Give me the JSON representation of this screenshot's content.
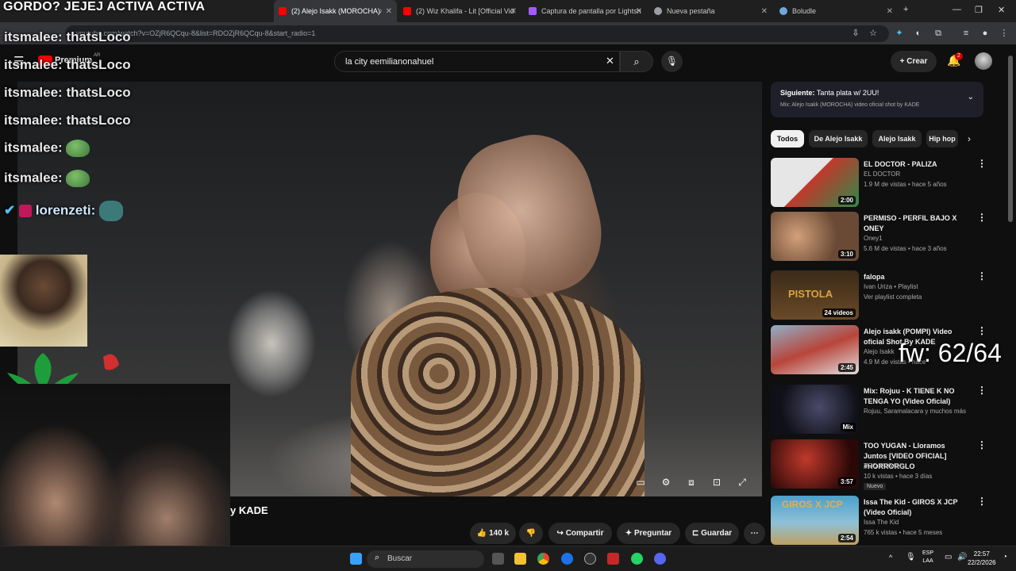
{
  "stream_overlay": {
    "banner": "GORDO? JEJEJ ACTIVA ACTIVA",
    "chat": [
      {
        "user": "itsmalee:",
        "text": "thatsLoco"
      },
      {
        "user": "itsmalee:",
        "text": "thatsLoco"
      },
      {
        "user": "itsmalee:",
        "text": "thatsLoco"
      },
      {
        "user": "itsmalee:",
        "text": "thatsLoco"
      },
      {
        "user": "itsmalee:",
        "text": ""
      },
      {
        "user": "itsmalee:",
        "text": ""
      },
      {
        "user": "lorenzeti:",
        "text": ""
      }
    ],
    "fw_counter": "fw: 62/64"
  },
  "browser": {
    "tabs": [
      {
        "label": "(2) Alejo Isakk (MOROCHA)",
        "color": "#ff0000"
      },
      {
        "label": "(2) Wiz Khalifa - Lit [Official Vid",
        "color": "#ff0000"
      },
      {
        "label": "Captura de pantalla por Lightsh",
        "color": "#a259ff"
      },
      {
        "label": "Nueva pestaña",
        "color": "#9aa0a6"
      },
      {
        "label": "Boludle",
        "color": "#6fa8dc"
      }
    ],
    "url": "youtube.com/watch?v=OZjR6QCqu-8&list=RDOZjR6QCqu-8&start_radio=1"
  },
  "youtube": {
    "logo": "Premium",
    "logo_region": "AR",
    "search_value": "la city eemilianonahuel",
    "create_label": "Crear",
    "notif_count": "2",
    "video_title_fragment": "y KADE",
    "actions": {
      "likes": "140 k",
      "share": "Compartir",
      "ask": "Preguntar",
      "save": "Guardar"
    },
    "next": {
      "label": "Siguiente:",
      "title": "Tanta plata w/ 2UU!",
      "sub": "Mix: Alejo Isakk (MOROCHA) video oficial shot by KADE"
    },
    "chips": [
      "Todos",
      "De Alejo Isakk",
      "Alejo Isakk",
      "Hip hop"
    ],
    "recommendations": [
      {
        "title": "EL DOCTOR - PALIZA",
        "channel": "EL DOCTOR",
        "meta": "1.9 M de vistas • hace 5 años",
        "badge": "2:00",
        "colors": [
          "#e6e6e6",
          "#c0392b"
        ]
      },
      {
        "title": "PERMISO - PERFIL BAJO X ONEY",
        "channel": "Oney1",
        "meta": "5.6 M de vistas • hace 3 años",
        "badge": "3:10",
        "colors": [
          "#9ec8e8",
          "#c48a60"
        ]
      },
      {
        "title": "falopa",
        "channel": "Ivan Uriza • Playlist",
        "meta": "Ver playlist completa",
        "badge": "24 videos",
        "colors": [
          "#3a2a18",
          "#d9a441"
        ]
      },
      {
        "title": "Alejo isakk (POMPI) Video oficial Shot By KADE",
        "channel": "Alejo Isakk",
        "meta": "4.9 M de vistas • hace",
        "badge": "2:45",
        "colors": [
          "#8fb0c8",
          "#b8453a"
        ]
      },
      {
        "title": "Mix: Rojuu - K TIENE K NO TENGA YO (Video Oficial)",
        "channel": "Rojuu, Saramalacara y muchos más",
        "meta": "",
        "badge": "Mix",
        "colors": [
          "#1a1a2a",
          "#cfcfcf"
        ]
      },
      {
        "title": "TOO YUGAN - Lloramos Juntos [VIDEO OFICIAL] #HORRORGLO",
        "channel": "TOO YUGAN",
        "meta": "10 k vistas • hace 3 días",
        "badge": "3:57",
        "colors": [
          "#5a0f0f",
          "#c0392b"
        ]
      },
      {
        "title": "Issa The Kid - GIROS X JCP (Video Oficial)",
        "channel": "Issa The Kid",
        "meta": "765 k vistas • hace 5 meses",
        "badge": "2:54",
        "colors": [
          "#4aa0c8",
          "#e0b050"
        ]
      }
    ],
    "new_badge": "Nuevo"
  },
  "taskbar": {
    "search": "Buscar",
    "lang_top": "ESP",
    "lang_bottom": "LAA",
    "time": "22:57",
    "date": "22/2/2026"
  }
}
